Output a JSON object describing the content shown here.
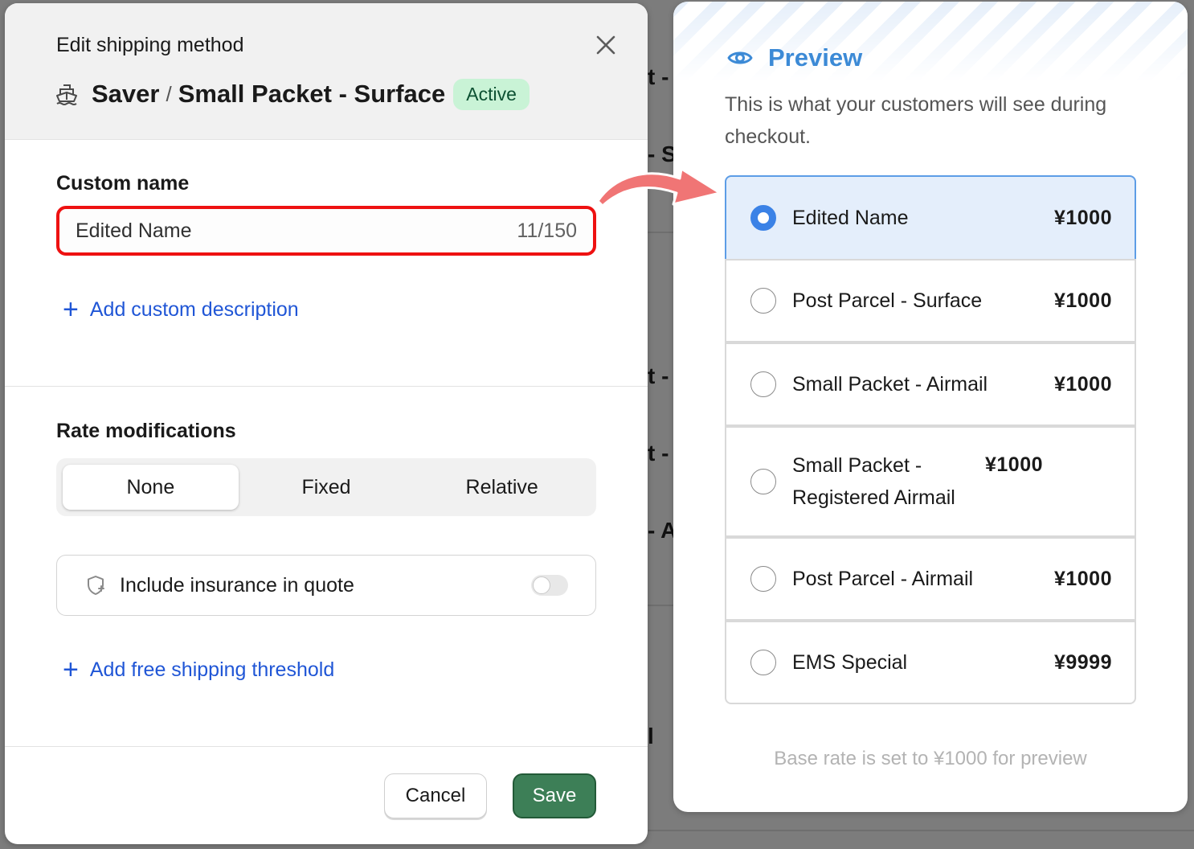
{
  "modal": {
    "kicker": "Edit shipping method",
    "title_parts": {
      "carrier": "Saver",
      "separator": "/",
      "service": "Small Packet - Surface"
    },
    "status_badge": "Active",
    "custom_name": {
      "label": "Custom name",
      "value": "Edited Name",
      "counter": "11/150"
    },
    "add_description_link": "Add custom description",
    "rate_modifications": {
      "label": "Rate modifications",
      "options": [
        "None",
        "Fixed",
        "Relative"
      ],
      "selected": "None"
    },
    "insurance": {
      "label": "Include insurance in quote",
      "enabled": false
    },
    "add_threshold_link": "Add free shipping threshold",
    "buttons": {
      "cancel": "Cancel",
      "save": "Save"
    }
  },
  "preview": {
    "title": "Preview",
    "subtitle": "This is what your customers will see during checkout.",
    "options": [
      {
        "name": "Edited Name",
        "price": "¥1000",
        "selected": true
      },
      {
        "name": "Post Parcel - Surface",
        "price": "¥1000",
        "selected": false
      },
      {
        "name": "Small Packet - Airmail",
        "price": "¥1000",
        "selected": false
      },
      {
        "name": "Small Packet - Registered Airmail",
        "price": "¥1000",
        "selected": false
      },
      {
        "name": "Post Parcel - Airmail",
        "price": "¥1000",
        "selected": false
      },
      {
        "name": "EMS Special",
        "price": "¥9999",
        "selected": false
      }
    ],
    "footnote": "Base rate is set to ¥1000 for preview"
  },
  "background_fragments": [
    "t -",
    "- S",
    "t -",
    "t -",
    "- A",
    "l"
  ],
  "colors": {
    "accent_link": "#2056d6",
    "badge_bg": "#c9f3d6",
    "save_green": "#3d7f57",
    "highlight_red": "#ee1111",
    "preview_blue": "#3c8ad6",
    "selected_option_bg": "#e4eefb",
    "arrow": "#f07575"
  },
  "icons": {
    "close": "close-icon",
    "ship": "ship-icon",
    "plus": "plus-icon",
    "shield": "shield-plus-icon",
    "eye": "eye-icon",
    "arrow": "curved-arrow-icon"
  }
}
